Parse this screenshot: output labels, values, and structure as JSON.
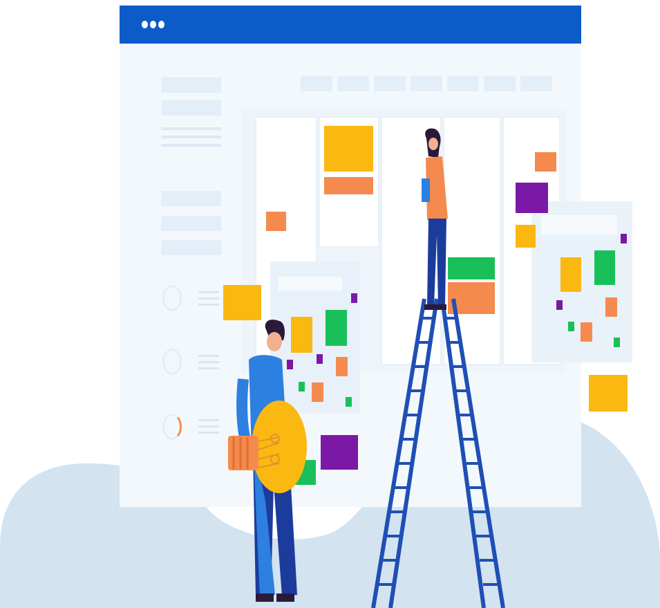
{
  "colors": {
    "titlebar": "#0b5cc8",
    "window_bg": "#f3f8fc",
    "blob": "#d3e3f0",
    "yellow": "#fbb811",
    "orange": "#f58a4e",
    "purple": "#7b19a6",
    "green": "#19c05a",
    "ladder": "#1f4fb5",
    "shirt_blue": "#2d7fe0",
    "pants_navy": "#1c3c9c"
  },
  "window": {
    "control_icon": "three-dots-icon",
    "dots": 3
  },
  "illustration": {
    "figures": [
      "man-with-lightbulb",
      "woman-on-ladder"
    ],
    "icons": [
      "lightbulb-icon",
      "ladder-icon"
    ]
  }
}
